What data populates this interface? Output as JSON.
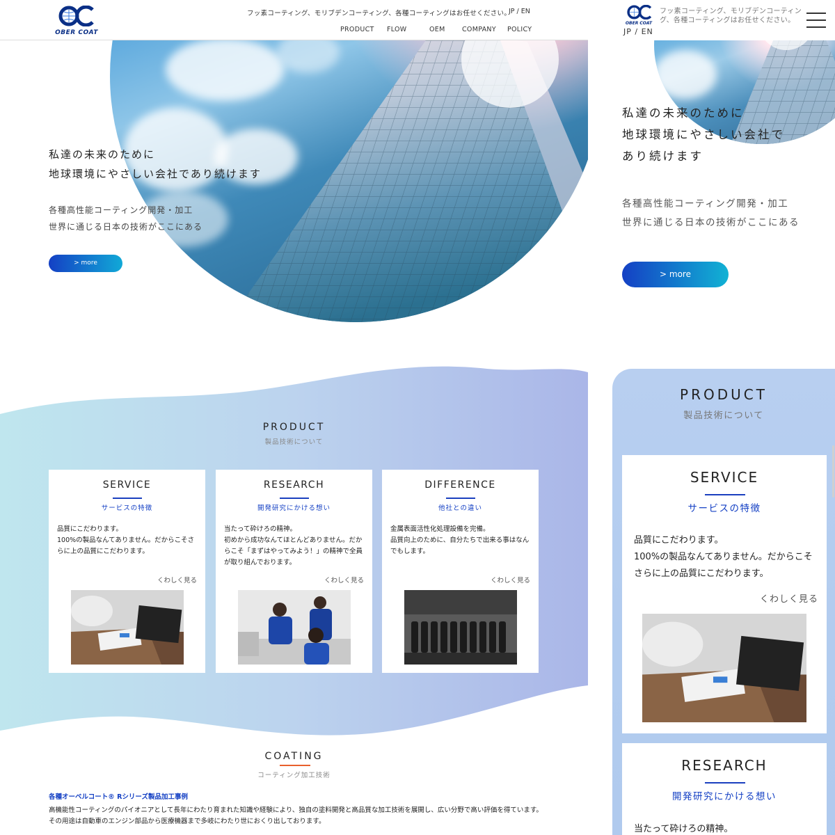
{
  "brand": {
    "logo_text": "OBER COAT",
    "primary_color": "#1440c4",
    "accent_gradient": [
      "#1440c4",
      "#11a9d7"
    ],
    "coating_accent": "#e8602c"
  },
  "header": {
    "tagline": "フッ素コーティング、モリブデンコーティング、各種コーティングはお任せください。",
    "lang": "JP / EN",
    "nav": [
      "PRODUCT",
      "FLOW",
      "OEM",
      "COMPANY",
      "POLICY"
    ]
  },
  "hero": {
    "title_line1": "私達の未来のために",
    "title_line2": "地球環境にやさしい会社であり続けます",
    "sub_line1": "各種高性能コーティング開発・加工",
    "sub_line2": "世界に通じる日本の技術がここにある",
    "more_label": "> more"
  },
  "product": {
    "title": "PRODUCT",
    "subtitle": "製品技術について",
    "cards": [
      {
        "title": "SERVICE",
        "subtitle": "サービスの特徴",
        "body": "品質にこだわります。\n100%の製品なんてありません。だからこそさらに上の品質にこだわります。",
        "more": "くわしく見る",
        "image_icon": "business-meeting-photo"
      },
      {
        "title": "RESEARCH",
        "subtitle": "開発研究にかける想い",
        "body": "当たって砕けろの精神。\n初めから成功なんてほとんどありません。だからこそ「まずはやってみよう！」の精神で全員が取り組んでおります。",
        "more": "くわしく見る",
        "image_icon": "research-team-photo"
      },
      {
        "title": "DIFFERENCE",
        "subtitle": "他社との違い",
        "body": "金属表面活性化処理設備を完備。\n品質向上のために、自分たちで出来る事はなんでもします。",
        "more": "くわしく見る",
        "image_icon": "coated-parts-photo"
      }
    ]
  },
  "coating": {
    "title": "COATING",
    "subtitle": "コーティング加工技術",
    "heading": "各種オーベルコート® Rシリーズ製品加工事例",
    "body": "高機能性コーティングのパイオニアとして長年にわたり育まれた知識や経験により、独自の塗料開発と高品質な加工技術を展開し、広い分野で高い評価を得ています。\nその用途は自動車のエンジン部品から医療機器まで多岐にわたり世におくり出しております。"
  },
  "mobile": {
    "tagline": "フッ素コーティング、モリブデンコーティング、各種コーティングはお任せください。",
    "lang": "JP / EN",
    "hero_title_line1": "私達の未来のために",
    "hero_title_line2": "地球環境にやさしい会社で",
    "hero_title_line3": "あり続けます",
    "cards_visible": [
      "SERVICE",
      "RESEARCH"
    ],
    "research_body_start": "当たって砕けろの精神。"
  }
}
